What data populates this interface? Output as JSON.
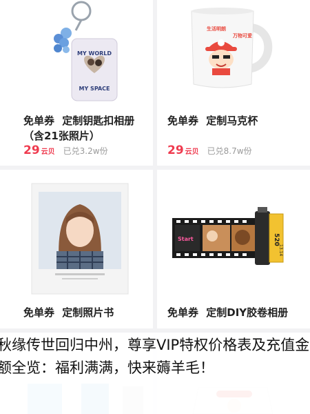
{
  "products": [
    {
      "badge": "免单券",
      "name": "定制钥匙扣相册（含21张照片）",
      "price": "29",
      "unit": "云贝",
      "sold": "已兑3.2w份",
      "image": {
        "icon": "keychain-photo-album",
        "label_top": "MY WORLD",
        "label_bottom": "MY SPACE"
      }
    },
    {
      "badge": "免单券",
      "name": "定制马克杯",
      "price": "29",
      "unit": "云贝",
      "sold": "已兑8.7w份",
      "image": {
        "icon": "mug-cartoon",
        "text_left": "生活明朗",
        "text_right": "万物可爱"
      }
    },
    {
      "badge": "免单券",
      "name": "定制照片书",
      "price": "",
      "unit": "",
      "sold": "",
      "image": {
        "icon": "photo-book"
      }
    },
    {
      "badge": "免单券",
      "name": "定制DIY胶卷相册",
      "price": "",
      "unit": "",
      "sold": "",
      "image": {
        "icon": "film-roll-album",
        "film_text": "520",
        "film_sub": "13.14",
        "start_text": "Start"
      }
    }
  ],
  "headline": "秋缘传世回归中州，尊享VIP特权价格表及充值金额全览：福利满满，快来薅羊毛！",
  "colors": {
    "accent": "#ef3b4f",
    "text": "#222222",
    "muted": "#9a9a9a"
  }
}
